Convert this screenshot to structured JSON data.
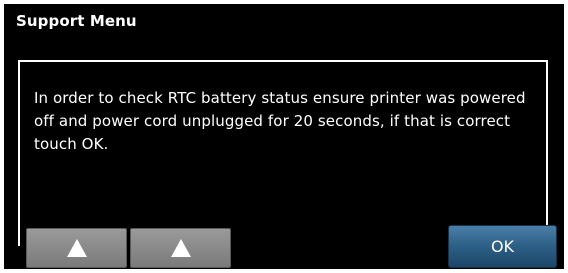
{
  "window": {
    "title": "Support Menu"
  },
  "dialog": {
    "message": "In order to check RTC battery status ensure printer was powered off and power cord unplugged for 20 seconds, if that is correct touch OK."
  },
  "buttons": {
    "scroll_up_icon": "up-triangle",
    "ok_label": "OK"
  },
  "colors": {
    "background": "#000000",
    "text": "#ffffff",
    "ok_button": "#2d5f86",
    "nav_button": "#8a8a8a"
  }
}
